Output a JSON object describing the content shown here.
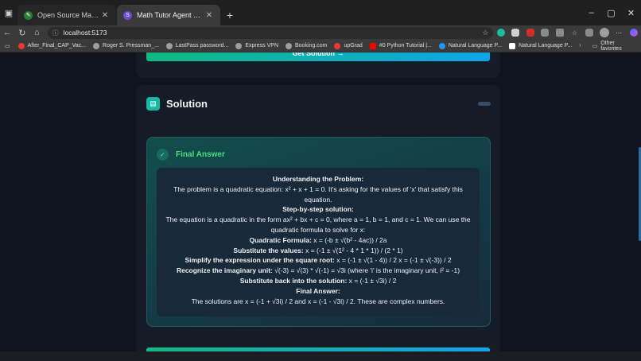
{
  "browser": {
    "tabs": [
      {
        "title": "Open Source Math Routing Agen",
        "active": false,
        "favicon_color": "#2e7d32"
      },
      {
        "title": "Math Tutor Agent Frontend Appli",
        "active": true,
        "favicon_color": "#6d4bd1"
      }
    ],
    "new_tab": "+",
    "window_controls": [
      "–",
      "▢",
      "✕"
    ],
    "address": "localhost:5173",
    "bookmarks": [
      {
        "label": "After_Final_CAP_Vac...",
        "color": "#e53935"
      },
      {
        "label": "Roger S. Pressman_...",
        "color": "#9e9e9e"
      },
      {
        "label": "LastPass password...",
        "color": "#9e9e9e"
      },
      {
        "label": "Express VPN",
        "color": "#9e9e9e"
      },
      {
        "label": "Booking.com",
        "color": "#9e9e9e"
      },
      {
        "label": "upGrad",
        "color": "#e53935"
      },
      {
        "label": "#0 Python Tutorial |...",
        "color": "#ff0000"
      },
      {
        "label": "Natural Language P...",
        "color": "#2196f3"
      },
      {
        "label": "Natural Language P...",
        "color": "#ffffff"
      }
    ],
    "other_favorites": "Other favorites"
  },
  "page": {
    "get_solution_label": "Get Solution →",
    "solution_title": "Solution",
    "final_answer_title": "Final Answer",
    "answer_lines": [
      {
        "bold": "Understanding the Problem:",
        "text": ""
      },
      {
        "bold": "",
        "text": "The problem is a quadratic equation: x² + x + 1 = 0. It's asking for the values of 'x' that satisfy this equation."
      },
      {
        "bold": "Step-by-step solution:",
        "text": ""
      },
      {
        "bold": "",
        "text": "The equation is a quadratic in the form ax² + bx + c = 0, where a = 1, b = 1, and c = 1. We can use the quadratic formula to solve for x:"
      },
      {
        "bold": "Quadratic Formula:",
        "text": " x = (-b ± √(b² - 4ac)) / 2a"
      },
      {
        "bold": "Substitute the values:",
        "text": " x = (-1 ± √(1² - 4 * 1 * 1)) / (2 * 1)"
      },
      {
        "bold": "Simplify the expression under the square root:",
        "text": " x = (-1 ± √(1 - 4)) / 2 x = (-1 ± √(-3)) / 2"
      },
      {
        "bold": "Recognize the imaginary unit:",
        "text": " √(-3) = √(3) * √(-1) = √3i (where 'i' is the imaginary unit, i² = -1)"
      },
      {
        "bold": "Substitute back into the solution:",
        "text": " x = (-1 ± √3i) / 2"
      },
      {
        "bold": "Final Answer:",
        "text": ""
      },
      {
        "bold": "",
        "text": "The solutions are x = (-1 + √3i) / 2 and x = (-1 - √3i) / 2. These are complex numbers."
      }
    ]
  }
}
